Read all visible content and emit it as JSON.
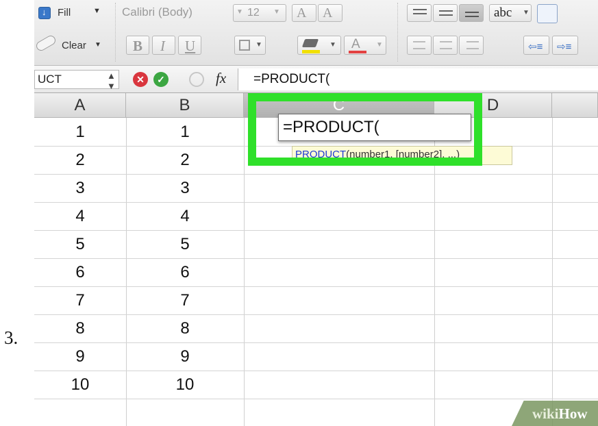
{
  "step_number": "3.",
  "ribbon": {
    "fill_label": "Fill",
    "clear_label": "Clear",
    "font_name": "Calibri (Body)",
    "font_size": "12",
    "increase_font": "A",
    "decrease_font": "A",
    "bold": "B",
    "italic": "I",
    "underline": "U",
    "wrap_label": "abc",
    "font_color_letter": "A"
  },
  "formula_bar": {
    "name_box": "UCT",
    "fx_label": "fx",
    "formula": "=PRODUCT("
  },
  "columns": [
    "A",
    "B",
    "C",
    "D"
  ],
  "rows": [
    [
      "1",
      "1"
    ],
    [
      "2",
      "2"
    ],
    [
      "3",
      "3"
    ],
    [
      "4",
      "4"
    ],
    [
      "5",
      "5"
    ],
    [
      "6",
      "6"
    ],
    [
      "7",
      "7"
    ],
    [
      "8",
      "8"
    ],
    [
      "9",
      "9"
    ],
    [
      "10",
      "10"
    ]
  ],
  "editing_cell": {
    "value": "=PRODUCT("
  },
  "tooltip": {
    "function": "PRODUCT",
    "args": "(number1, [number2], ...)"
  },
  "highlight_color": "#2fe02a",
  "watermark": {
    "part1": "wiki",
    "part2": "How"
  }
}
